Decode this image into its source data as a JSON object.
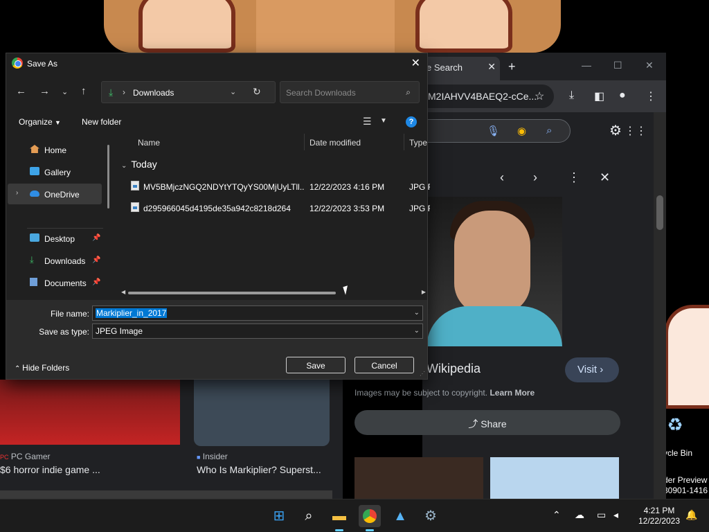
{
  "desktop": {
    "recycle_bin_label": "ycle Bin",
    "preview_line1": "der Preview",
    "preview_line2": "30901-1416"
  },
  "browser": {
    "tab_title": "e Search",
    "url_fragment": "M2IAHVV4BAEQ2-cCe...",
    "wikipedia_title": "Wikipedia",
    "visit_label": "Visit",
    "copyright_text": "Images may be subject to copyright.",
    "learn_more": "Learn More",
    "share_label": "Share"
  },
  "background_results": [
    {
      "source": "PC Gamer",
      "title": "$6 horror indie game ..."
    },
    {
      "source": "Insider",
      "title": "Who Is Markiplier? Superst..."
    }
  ],
  "dialog": {
    "title": "Save As",
    "breadcrumb": "Downloads",
    "search_placeholder": "Search Downloads",
    "organize_label": "Organize",
    "new_folder_label": "New folder",
    "sidebar": [
      {
        "label": "Home"
      },
      {
        "label": "Gallery"
      },
      {
        "label": "OneDrive"
      },
      {
        "label": "Desktop"
      },
      {
        "label": "Downloads"
      },
      {
        "label": "Documents"
      }
    ],
    "columns": {
      "name": "Name",
      "date": "Date modified",
      "type": "Type"
    },
    "group_label": "Today",
    "files": [
      {
        "name": "MV5BMjczNGQ2NDYtYTQyYS00MjUyLTll...",
        "date": "12/22/2023 4:16 PM",
        "type": "JPG F"
      },
      {
        "name": "d295966045d4195de35a942c8218d264",
        "date": "12/22/2023 3:53 PM",
        "type": "JPG F"
      }
    ],
    "file_name_label": "File name:",
    "file_name_value": "Markiplier_in_2017",
    "save_type_label": "Save as type:",
    "save_type_value": "JPEG Image",
    "hide_folders_label": "Hide Folders",
    "save_label": "Save",
    "cancel_label": "Cancel"
  },
  "taskbar": {
    "time": "4:21 PM",
    "date": "12/22/2023"
  },
  "colors": {
    "accent": "#0078d4",
    "dialog_bg": "#202020",
    "taskbar_bg": "#1c1c1c"
  }
}
